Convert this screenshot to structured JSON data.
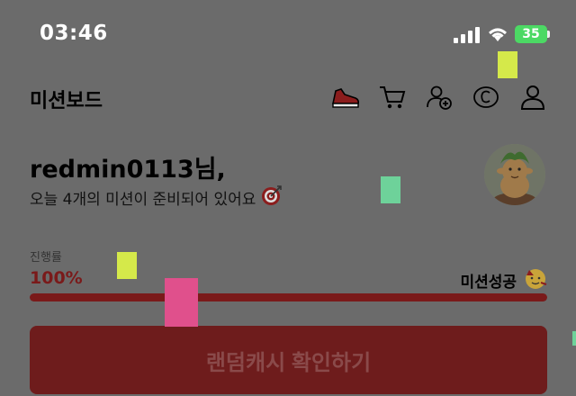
{
  "status_bar": {
    "time": "03:46",
    "battery": "35"
  },
  "header": {
    "title": "미션보드",
    "icons": [
      "sneaker-icon",
      "cart-icon",
      "add-friend-icon",
      "coin-icon",
      "profile-icon"
    ]
  },
  "greeting": {
    "name": "redmin0113님,",
    "subtitle": "오늘 4개의 미션이 준비되어 있어요"
  },
  "progress": {
    "label": "진행률",
    "value": "100%",
    "fraction": 1.0,
    "success_label": "미션성공"
  },
  "cta": {
    "label": "랜덤캐시 확인하기"
  },
  "colors": {
    "accent": "#7a1a1a",
    "overlay_bg": "#6b6b6b",
    "battery": "#4cd964"
  }
}
